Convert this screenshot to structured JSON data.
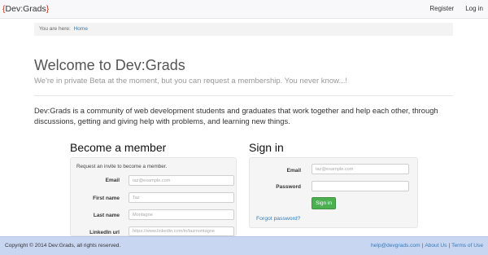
{
  "navbar": {
    "brand_open": "{",
    "brand_text": "Dev:Grads",
    "brand_close": "}",
    "links": [
      "Register",
      "Log in"
    ]
  },
  "breadcrumb": {
    "prefix": "You are here:",
    "current": "Home"
  },
  "welcome": {
    "title": "Welcome to Dev:Grads",
    "subtitle": "We're in private Beta at the moment, but you can request a membership. You never know...!"
  },
  "intro": "Dev:Grads is a community of web development students and graduates that work together and help each other, through discussions, getting and giving help with problems, and learning new things.",
  "become_member": {
    "title": "Become a member",
    "note": "Request an invite to become a member.",
    "fields": [
      {
        "label": "Email",
        "placeholder": "taz@example.com"
      },
      {
        "label": "First name",
        "placeholder": "Taz"
      },
      {
        "label": "Last name",
        "placeholder": "Montagne"
      },
      {
        "label": "LinkedIn url",
        "placeholder": "https://www.linkedin.com/in/tazmontagne"
      }
    ]
  },
  "sign_in": {
    "title": "Sign in",
    "email_label": "Email",
    "email_placeholder": "taz@example.com",
    "password_label": "Password",
    "password_placeholder": "",
    "button": "Sign in",
    "forgot": "Forgot password?"
  },
  "footer": {
    "copyright": "Copyright © 2014 Dev:Grads, all rights reserved.",
    "email": "help@devgrads.com",
    "sep": "|",
    "about": "About Us",
    "terms": "Terms of Use"
  },
  "colors": {
    "navbar_bg": "#f8f8fb",
    "footer_bg": "#c9d6f2",
    "link": "#337ab7",
    "button_green": "#4caf50",
    "brand_braces": "#c0392b"
  }
}
